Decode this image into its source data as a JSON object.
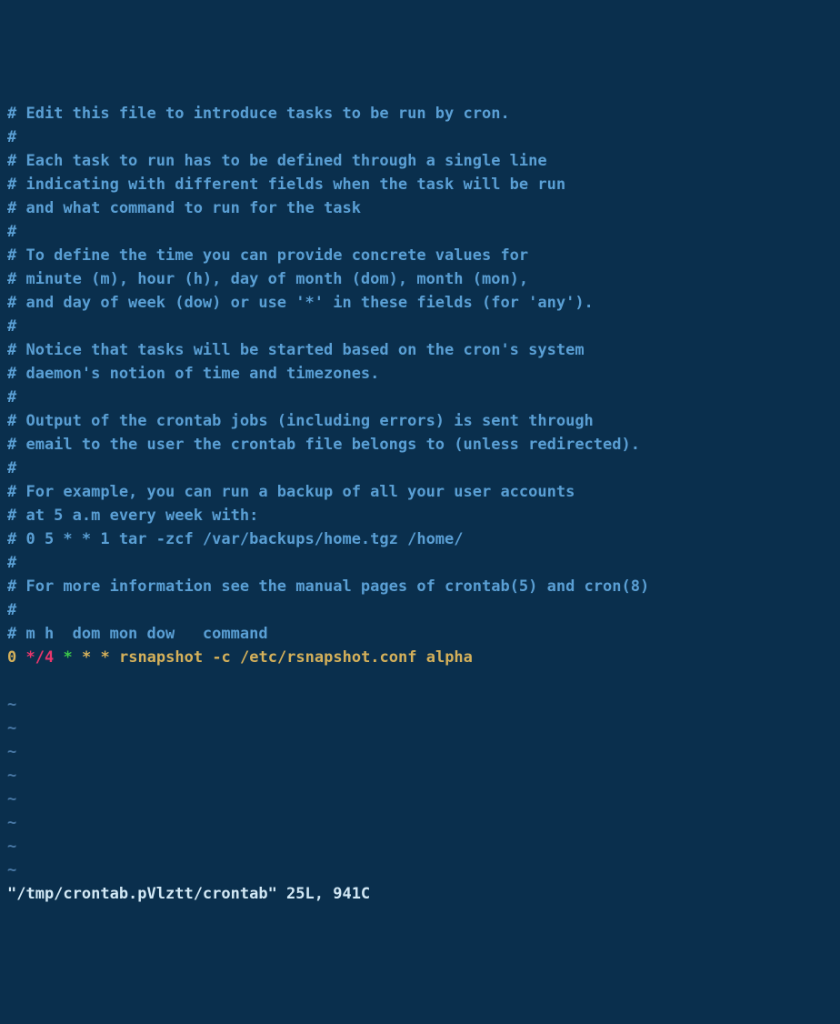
{
  "lines": {
    "c0": "# Edit this file to introduce tasks to be run by cron.",
    "c1": "#",
    "c2": "# Each task to run has to be defined through a single line",
    "c3": "# indicating with different fields when the task will be run",
    "c4": "# and what command to run for the task",
    "c5": "#",
    "c6": "# To define the time you can provide concrete values for",
    "c7": "# minute (m), hour (h), day of month (dom), month (mon),",
    "c8": "# and day of week (dow) or use '*' in these fields (for 'any').",
    "c9": "#",
    "c10": "# Notice that tasks will be started based on the cron's system",
    "c11": "# daemon's notion of time and timezones.",
    "c12": "#",
    "c13": "# Output of the crontab jobs (including errors) is sent through",
    "c14": "# email to the user the crontab file belongs to (unless redirected).",
    "c15": "#",
    "c16": "# For example, you can run a backup of all your user accounts",
    "c17": "# at 5 a.m every week with:",
    "c18": "# 0 5 * * 1 tar -zcf /var/backups/home.tgz /home/",
    "c19": "#",
    "c20": "# For more information see the manual pages of crontab(5) and cron(8)",
    "c21": "#",
    "c22": "# m h  dom mon dow   command"
  },
  "cronEntry": {
    "minute": "0",
    "hour": "*/4",
    "dom": "*",
    "mon": "*",
    "dow": "*",
    "command": "rsnapshot -c /etc/rsnapshot.conf alpha"
  },
  "tilde": "~",
  "statusLine": "\"/tmp/crontab.pVlztt/crontab\" 25L, 941C"
}
